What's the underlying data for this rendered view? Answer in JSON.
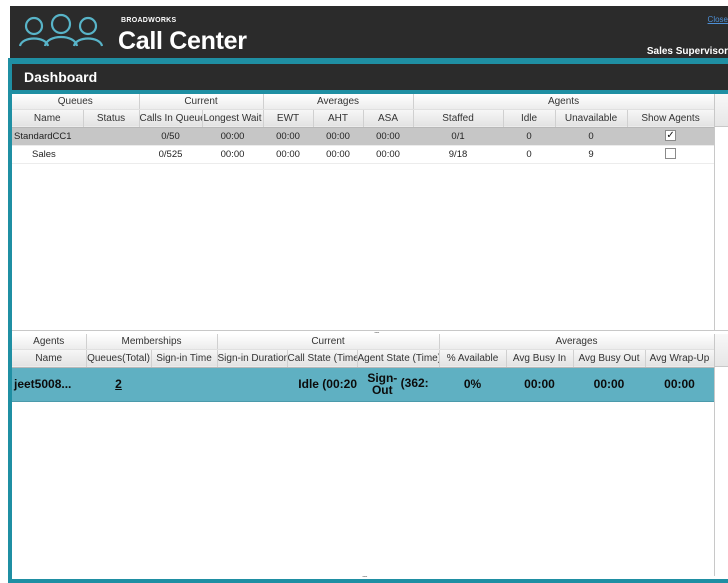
{
  "header": {
    "brand_small": "BROADWORKS",
    "brand_large": "Call Center",
    "close_label": "Close",
    "user_title": "Sales Supervisor"
  },
  "dashboard": {
    "title": "Dashboard"
  },
  "queues_table": {
    "groups": [
      "Queues",
      "Current",
      "Averages",
      "Agents"
    ],
    "columns": [
      "Name",
      "Status",
      "Calls In Queue",
      "Longest Wait",
      "EWT",
      "AHT",
      "ASA",
      "Staffed",
      "Idle",
      "Unavailable",
      "Show Agents"
    ],
    "rows": [
      {
        "name": "StandardCC1",
        "status": "",
        "calls_in_queue": "0/50",
        "longest_wait": "00:00",
        "ewt": "00:00",
        "aht": "00:00",
        "asa": "00:00",
        "staffed": "0/1",
        "idle": "0",
        "unavailable": "0",
        "show_agents": true,
        "show_agents_glyph": "✓"
      },
      {
        "name": "Sales",
        "status": "",
        "calls_in_queue": "0/525",
        "longest_wait": "00:00",
        "ewt": "00:00",
        "aht": "00:00",
        "asa": "00:00",
        "staffed": "9/18",
        "idle": "0",
        "unavailable": "9",
        "show_agents": false,
        "show_agents_glyph": ""
      }
    ]
  },
  "agents_table": {
    "groups": [
      "Agents",
      "Memberships",
      "Current",
      "Averages"
    ],
    "columns": [
      "Name",
      "Queues(Total)",
      "Sign-in Time",
      "Sign-in Duration",
      "Call State (Time)",
      "Agent State (Time)",
      "% Available",
      "Avg Busy In",
      "Avg Busy Out",
      "Avg Wrap-Up"
    ],
    "rows": [
      {
        "name": "jeet5008...",
        "queues_total": "2",
        "sign_in_time": "",
        "sign_in_duration": "",
        "call_state": "Idle (00:20",
        "agent_state_top": "Sign-",
        "agent_state_bottom": "Out",
        "agent_state_time": "(362:",
        "pct_available": "0%",
        "avg_busy_in": "00:00",
        "avg_busy_out": "00:00",
        "avg_wrap_up": "00:00"
      }
    ]
  },
  "splitter_grip": "....."
}
